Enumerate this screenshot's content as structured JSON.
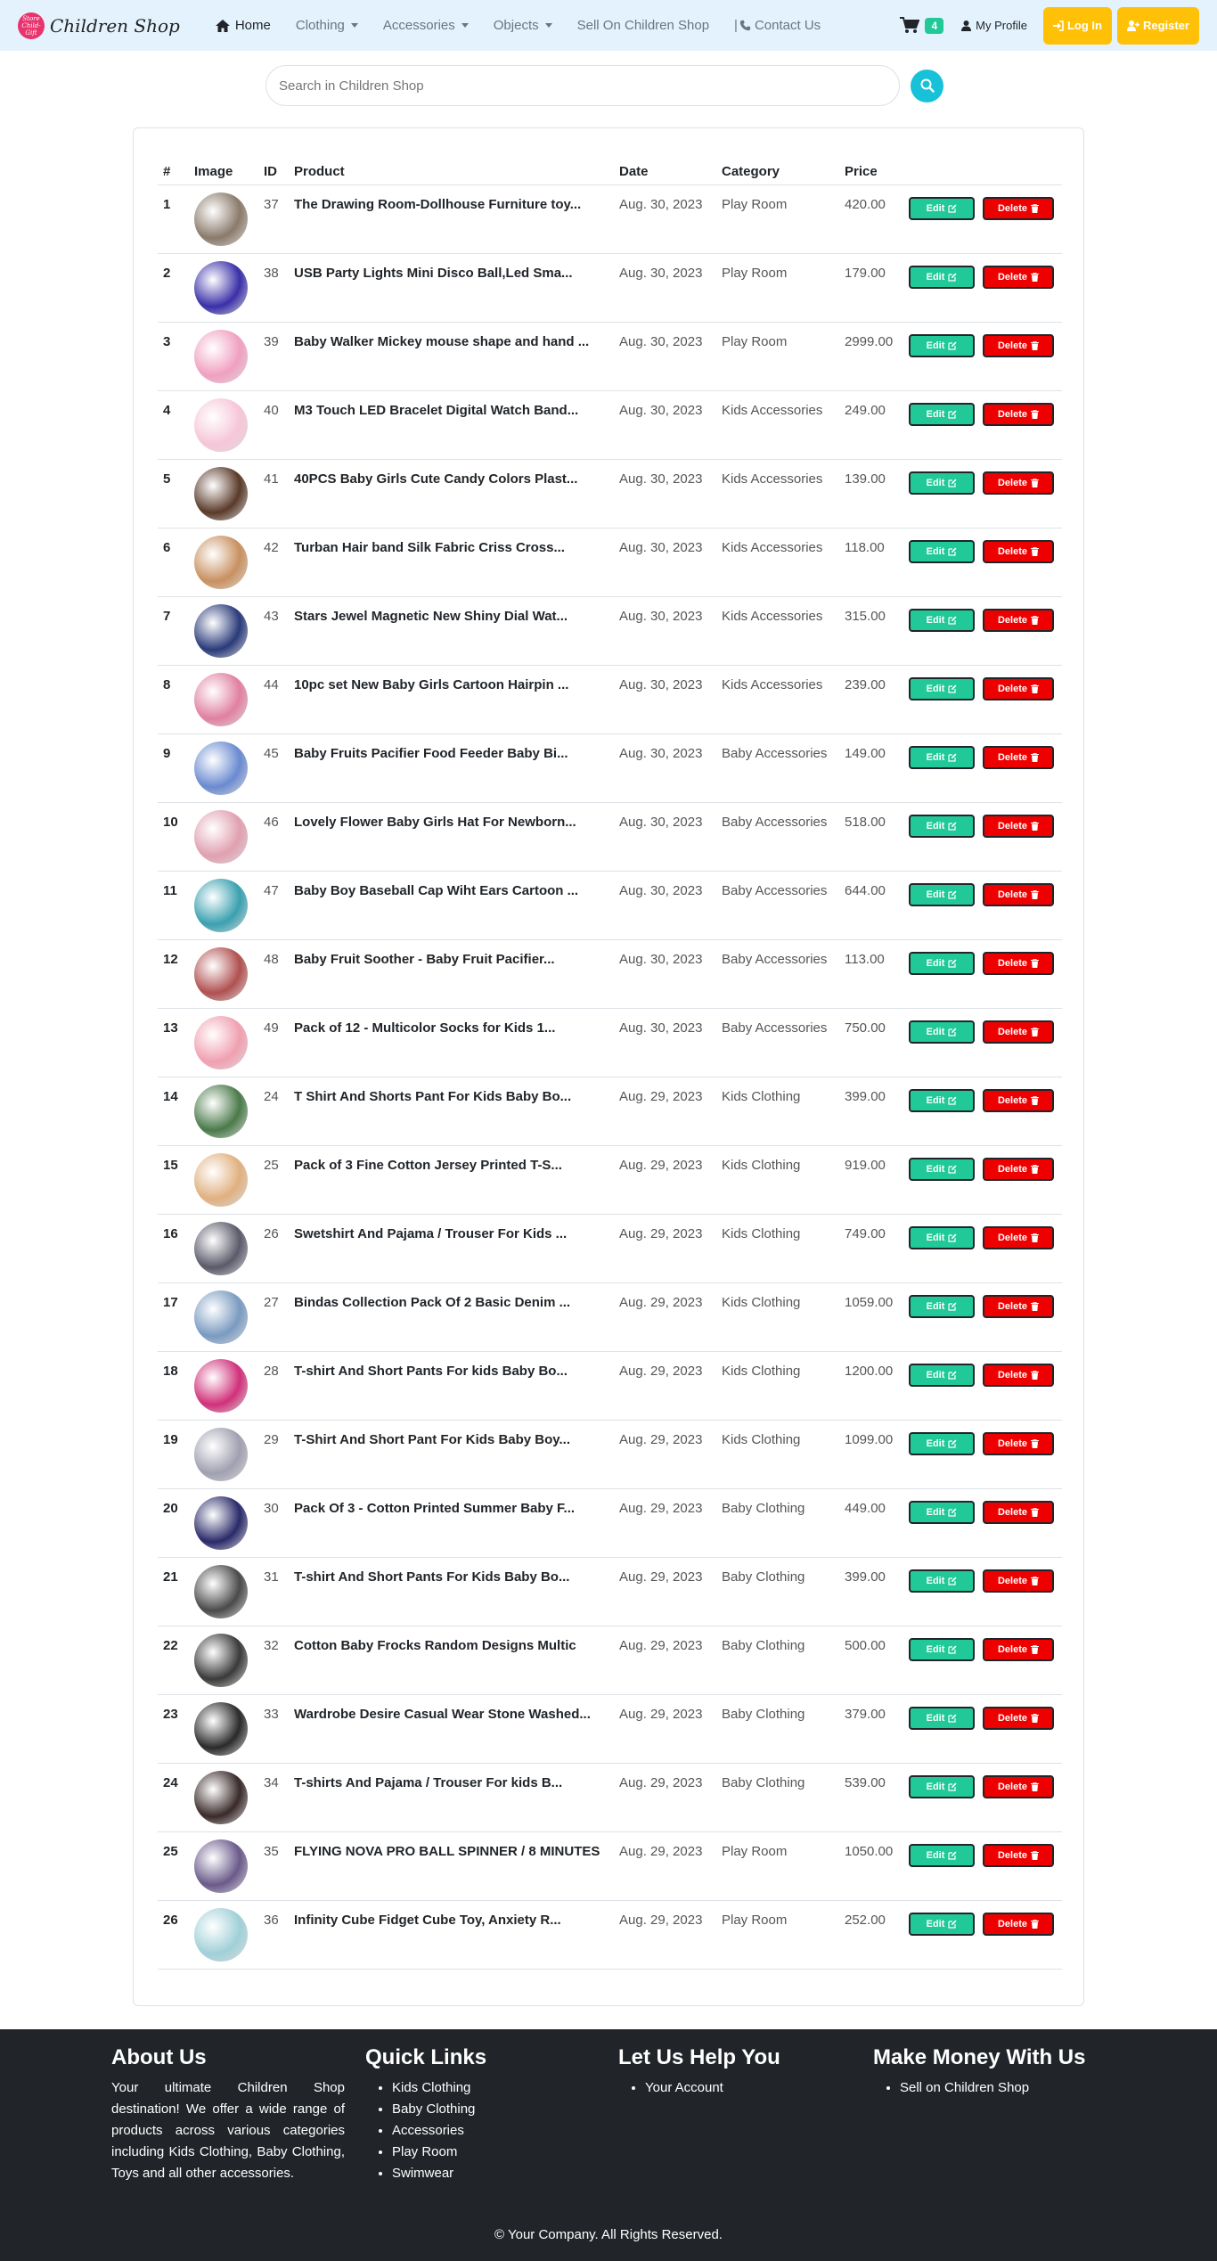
{
  "brand": {
    "name": "Children Shop",
    "logo_text": "Store\nChild-Gift"
  },
  "nav": {
    "home": "Home",
    "clothing": "Clothing",
    "accessories": "Accessories",
    "objects": "Objects",
    "sell": "Sell On Children Shop",
    "contact_sep": "|",
    "contact": "Contact Us",
    "cart_count": "4",
    "profile": "My Profile",
    "login": "Log In",
    "register": "Register"
  },
  "search": {
    "placeholder": "Search in Children Shop"
  },
  "table": {
    "headers": [
      "#",
      "Image",
      "ID",
      "Product",
      "Date",
      "Category",
      "Price"
    ],
    "edit_label": "Edit",
    "delete_label": "Delete",
    "rows": [
      {
        "n": "1",
        "id": "37",
        "product": "The Drawing Room-Dollhouse Furniture toy...",
        "date": "Aug. 30, 2023",
        "category": "Play Room",
        "price": "420.00",
        "color": "#8a7a6a"
      },
      {
        "n": "2",
        "id": "38",
        "product": "USB Party Lights Mini Disco Ball,Led Sma...",
        "date": "Aug. 30, 2023",
        "category": "Play Room",
        "price": "179.00",
        "color": "#3a2fa8"
      },
      {
        "n": "3",
        "id": "39",
        "product": "Baby Walker Mickey mouse shape and hand ...",
        "date": "Aug. 30, 2023",
        "category": "Play Room",
        "price": "2999.00",
        "color": "#f0a0c0"
      },
      {
        "n": "4",
        "id": "40",
        "product": "M3 Touch LED Bracelet Digital Watch Band...",
        "date": "Aug. 30, 2023",
        "category": "Kids Accessories",
        "price": "249.00",
        "color": "#f6c6d8"
      },
      {
        "n": "5",
        "id": "41",
        "product": "40PCS Baby Girls Cute Candy Colors Plast...",
        "date": "Aug. 30, 2023",
        "category": "Kids Accessories",
        "price": "139.00",
        "color": "#5a3a2a"
      },
      {
        "n": "6",
        "id": "42",
        "product": "Turban Hair band Silk Fabric Criss Cross...",
        "date": "Aug. 30, 2023",
        "category": "Kids Accessories",
        "price": "118.00",
        "color": "#c89060"
      },
      {
        "n": "7",
        "id": "43",
        "product": "Stars Jewel Magnetic New Shiny Dial Wat...",
        "date": "Aug. 30, 2023",
        "category": "Kids Accessories",
        "price": "315.00",
        "color": "#2a3a7a"
      },
      {
        "n": "8",
        "id": "44",
        "product": "10pc set New Baby Girls Cartoon Hairpin ...",
        "date": "Aug. 30, 2023",
        "category": "Kids Accessories",
        "price": "239.00",
        "color": "#e080a0"
      },
      {
        "n": "9",
        "id": "45",
        "product": "Baby Fruits Pacifier Food Feeder Baby Bi...",
        "date": "Aug. 30, 2023",
        "category": "Baby Accessories",
        "price": "149.00",
        "color": "#6a8ad0"
      },
      {
        "n": "10",
        "id": "46",
        "product": "Lovely Flower Baby Girls Hat For Newborn...",
        "date": "Aug. 30, 2023",
        "category": "Baby Accessories",
        "price": "518.00",
        "color": "#e0a0b0"
      },
      {
        "n": "11",
        "id": "47",
        "product": "Baby Boy Baseball Cap Wiht Ears Cartoon ...",
        "date": "Aug. 30, 2023",
        "category": "Baby Accessories",
        "price": "644.00",
        "color": "#3aa0b0"
      },
      {
        "n": "12",
        "id": "48",
        "product": "Baby Fruit Soother - Baby Fruit Pacifier...",
        "date": "Aug. 30, 2023",
        "category": "Baby Accessories",
        "price": "113.00",
        "color": "#b05050"
      },
      {
        "n": "13",
        "id": "49",
        "product": "Pack of 12 - Multicolor Socks for Kids 1...",
        "date": "Aug. 30, 2023",
        "category": "Baby Accessories",
        "price": "750.00",
        "color": "#f0a0b0"
      },
      {
        "n": "14",
        "id": "24",
        "product": "T Shirt And Shorts Pant For Kids Baby Bo...",
        "date": "Aug. 29, 2023",
        "category": "Kids Clothing",
        "price": "399.00",
        "color": "#4a7a4a"
      },
      {
        "n": "15",
        "id": "25",
        "product": "Pack of 3 Fine Cotton Jersey Printed T-S...",
        "date": "Aug. 29, 2023",
        "category": "Kids Clothing",
        "price": "919.00",
        "color": "#e0b080"
      },
      {
        "n": "16",
        "id": "26",
        "product": "Swetshirt And Pajama / Trouser For Kids ...",
        "date": "Aug. 29, 2023",
        "category": "Kids Clothing",
        "price": "749.00",
        "color": "#5a5a6a"
      },
      {
        "n": "17",
        "id": "27",
        "product": "Bindas Collection Pack Of 2 Basic Denim ...",
        "date": "Aug. 29, 2023",
        "category": "Kids Clothing",
        "price": "1059.00",
        "color": "#7a9ac0"
      },
      {
        "n": "18",
        "id": "28",
        "product": "T-shirt And Short Pants For kids Baby Bo...",
        "date": "Aug. 29, 2023",
        "category": "Kids Clothing",
        "price": "1200.00",
        "color": "#d0307a"
      },
      {
        "n": "19",
        "id": "29",
        "product": "T-Shirt And Short Pant For Kids Baby Boy...",
        "date": "Aug. 29, 2023",
        "category": "Kids Clothing",
        "price": "1099.00",
        "color": "#a0a0b0"
      },
      {
        "n": "20",
        "id": "30",
        "product": "Pack Of 3 - Cotton Printed Summer Baby F...",
        "date": "Aug. 29, 2023",
        "category": "Baby Clothing",
        "price": "449.00",
        "color": "#2a2a6a"
      },
      {
        "n": "21",
        "id": "31",
        "product": "T-shirt And Short Pants For Kids Baby Bo...",
        "date": "Aug. 29, 2023",
        "category": "Baby Clothing",
        "price": "399.00",
        "color": "#4a4a4a"
      },
      {
        "n": "22",
        "id": "32",
        "product": "Cotton Baby Frocks Random Designs Multic",
        "date": "Aug. 29, 2023",
        "category": "Baby Clothing",
        "price": "500.00",
        "color": "#3a3a3a"
      },
      {
        "n": "23",
        "id": "33",
        "product": "Wardrobe Desire Casual Wear Stone Washed...",
        "date": "Aug. 29, 2023",
        "category": "Baby Clothing",
        "price": "379.00",
        "color": "#2a2a2a"
      },
      {
        "n": "24",
        "id": "34",
        "product": "T-shirts And Pajama / Trouser For kids B...",
        "date": "Aug. 29, 2023",
        "category": "Baby Clothing",
        "price": "539.00",
        "color": "#3a2a2a"
      },
      {
        "n": "25",
        "id": "35",
        "product": "FLYING NOVA PRO BALL SPINNER / 8 MINUTES",
        "date": "Aug. 29, 2023",
        "category": "Play Room",
        "price": "1050.00",
        "color": "#6a5a8a"
      },
      {
        "n": "26",
        "id": "36",
        "product": "Infinity Cube Fidget Cube Toy, Anxiety R...",
        "date": "Aug. 29, 2023",
        "category": "Play Room",
        "price": "252.00",
        "color": "#a0d0d8"
      }
    ]
  },
  "footer": {
    "about_title": "About Us",
    "about_text": "Your ultimate Children Shop destination! We offer a wide range of products across various categories including Kids Clothing, Baby Clothing, Toys and all other accessories.",
    "quick_title": "Quick Links",
    "quick_links": [
      "Kids Clothing",
      "Baby Clothing",
      "Accessories",
      "Play Room",
      "Swimwear"
    ],
    "help_title": "Let Us Help You",
    "help_links": [
      "Your Account"
    ],
    "money_title": "Make Money With Us",
    "money_links": [
      "Sell on Children Shop"
    ],
    "copyright": "© Your Company. All Rights Reserved."
  },
  "colors": {
    "navbar_bg": "#e3f2fd",
    "edit_btn": "#20c997",
    "delete_btn": "#ee0000",
    "auth_btn": "#ffc107",
    "footer_bg": "#212529",
    "search_btn": "#17c2d9"
  }
}
